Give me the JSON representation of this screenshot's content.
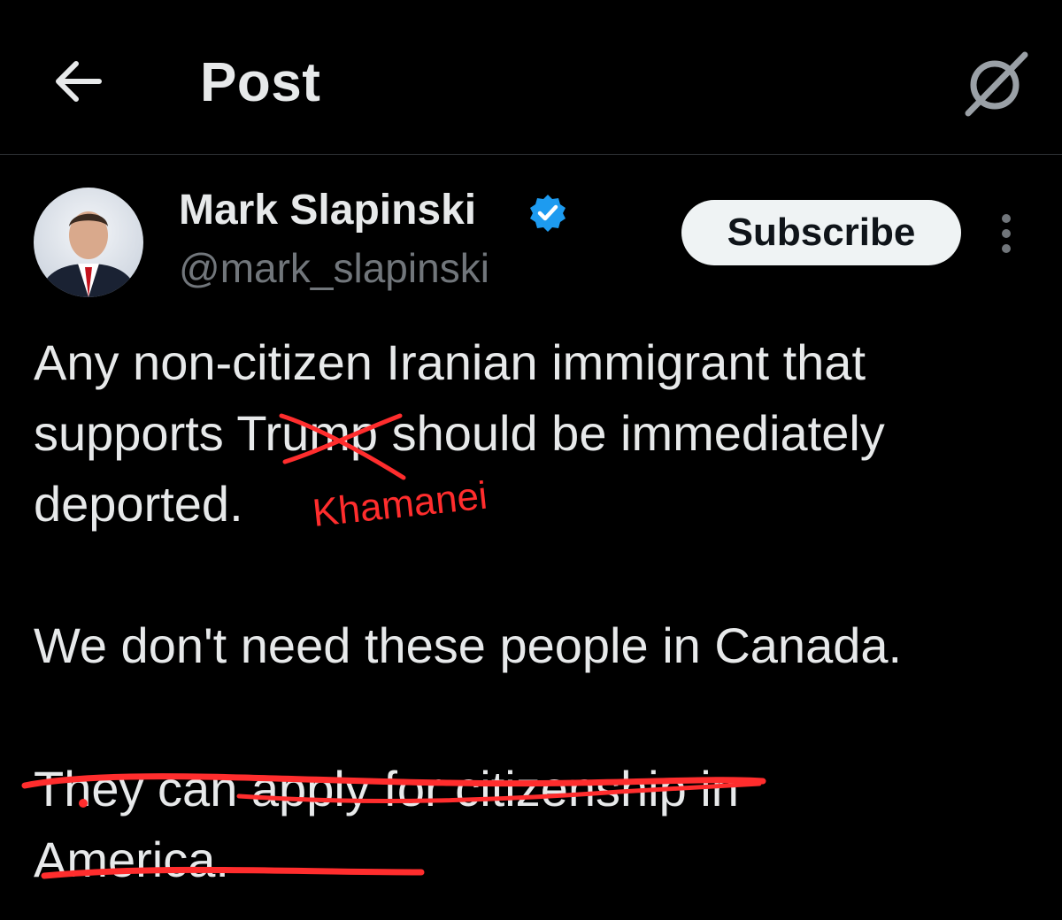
{
  "header": {
    "title": "Post",
    "back_icon": "arrow-left-icon",
    "grok_icon": "grok-icon"
  },
  "author": {
    "name": "Mark Slapinski",
    "handle": "@mark_slapinski",
    "verified": true,
    "verified_color": "#1d9bf0"
  },
  "actions": {
    "subscribe_label": "Subscribe",
    "more_icon": "more-vertical-icon"
  },
  "post": {
    "lines": [
      "Any non-citizen Iranian immigrant that",
      "supports Trump should be immediately",
      "deported.",
      "We don't need these people in Canada.",
      "They can apply for citizenship in",
      "America."
    ]
  },
  "annotation": {
    "handwritten_replacement": "Khamanei",
    "color": "#ff2d2d"
  },
  "colors": {
    "background": "#000000",
    "text": "#e7e9ea",
    "secondary_text": "#71767b",
    "divider": "#2f3336"
  }
}
